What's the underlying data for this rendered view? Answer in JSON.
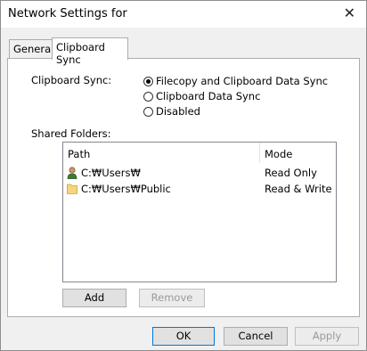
{
  "window": {
    "title": "Network Settings for"
  },
  "tabs": [
    {
      "label": "General"
    },
    {
      "label": "Clipboard Sync"
    }
  ],
  "clipboard_sync": {
    "label": "Clipboard Sync:",
    "options": [
      {
        "label": "Filecopy and Clipboard Data Sync",
        "selected": true
      },
      {
        "label": "Clipboard Data Sync",
        "selected": false
      },
      {
        "label": "Disabled",
        "selected": false
      }
    ]
  },
  "shared_folders": {
    "label": "Shared Folders:",
    "columns": {
      "path": "Path",
      "mode": "Mode"
    },
    "rows": [
      {
        "icon": "user-icon",
        "path": "C:₩Users₩",
        "mode": "Read Only"
      },
      {
        "icon": "folder-icon",
        "path": "C:₩Users₩Public",
        "mode": "Read & Write"
      }
    ]
  },
  "buttons": {
    "add": "Add",
    "remove": "Remove",
    "ok": "OK",
    "cancel": "Cancel",
    "apply": "Apply"
  },
  "icons": {
    "close": "close-icon"
  }
}
